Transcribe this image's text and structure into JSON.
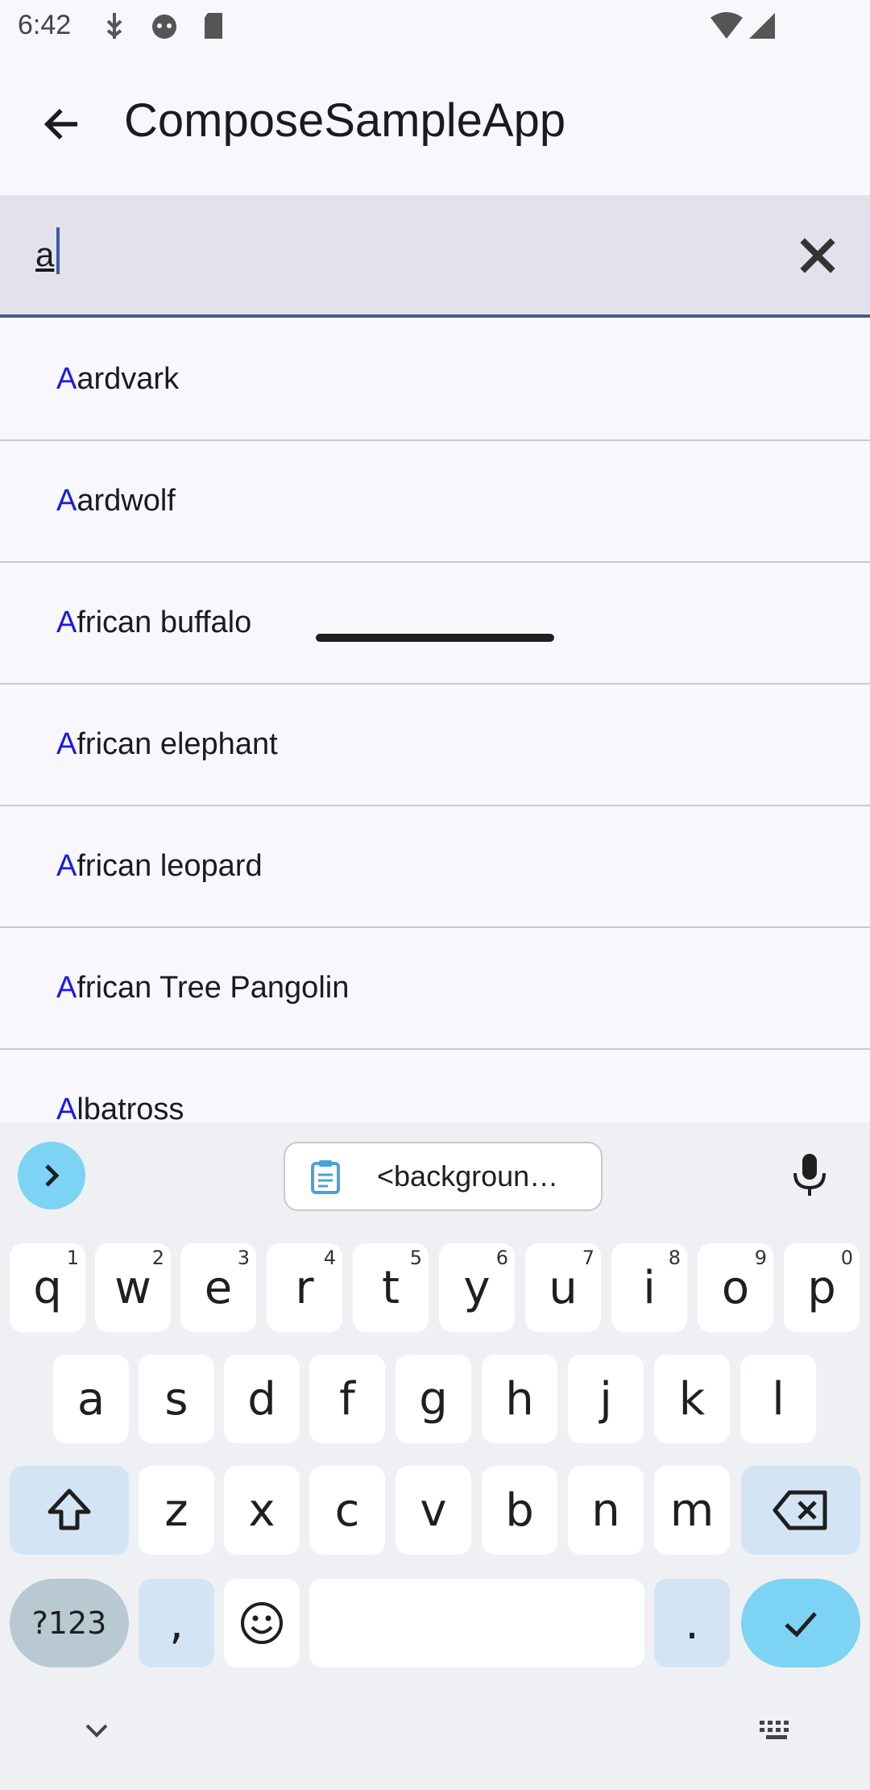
{
  "status_bar": {
    "time": "6:42",
    "icons": [
      "usb-debug-icon",
      "android-head-icon",
      "sd-card-icon",
      "wifi-icon",
      "signal-icon"
    ]
  },
  "app_bar": {
    "title": "ComposeSampleApp",
    "back_icon": "arrow-back-icon"
  },
  "search": {
    "value": "a",
    "clear_icon": "close-icon"
  },
  "results": [
    {
      "highlight": "A",
      "rest": "ardvark"
    },
    {
      "highlight": "A",
      "rest": "ardwolf"
    },
    {
      "highlight": "A",
      "rest": "frican buffalo"
    },
    {
      "highlight": "A",
      "rest": "frican elephant"
    },
    {
      "highlight": "A",
      "rest": "frican leopard"
    },
    {
      "highlight": "A",
      "rest": "frican Tree Pangolin"
    },
    {
      "highlight": "A",
      "rest": "lbatross"
    }
  ],
  "keyboard": {
    "clipboard_suggestion": "<backgroun…",
    "row1": [
      {
        "key": "q",
        "hint": "1"
      },
      {
        "key": "w",
        "hint": "2"
      },
      {
        "key": "e",
        "hint": "3"
      },
      {
        "key": "r",
        "hint": "4"
      },
      {
        "key": "t",
        "hint": "5"
      },
      {
        "key": "y",
        "hint": "6"
      },
      {
        "key": "u",
        "hint": "7"
      },
      {
        "key": "i",
        "hint": "8"
      },
      {
        "key": "o",
        "hint": "9"
      },
      {
        "key": "p",
        "hint": "0"
      }
    ],
    "row2": [
      "a",
      "s",
      "d",
      "f",
      "g",
      "h",
      "j",
      "k",
      "l"
    ],
    "row3": [
      "z",
      "x",
      "c",
      "v",
      "b",
      "n",
      "m"
    ],
    "symbols_label": "?123",
    "comma": ",",
    "period": "."
  },
  "colors": {
    "accent": "#1a1ae6",
    "underline": "#4a5a8c",
    "key_action": "#7dd3f4"
  }
}
